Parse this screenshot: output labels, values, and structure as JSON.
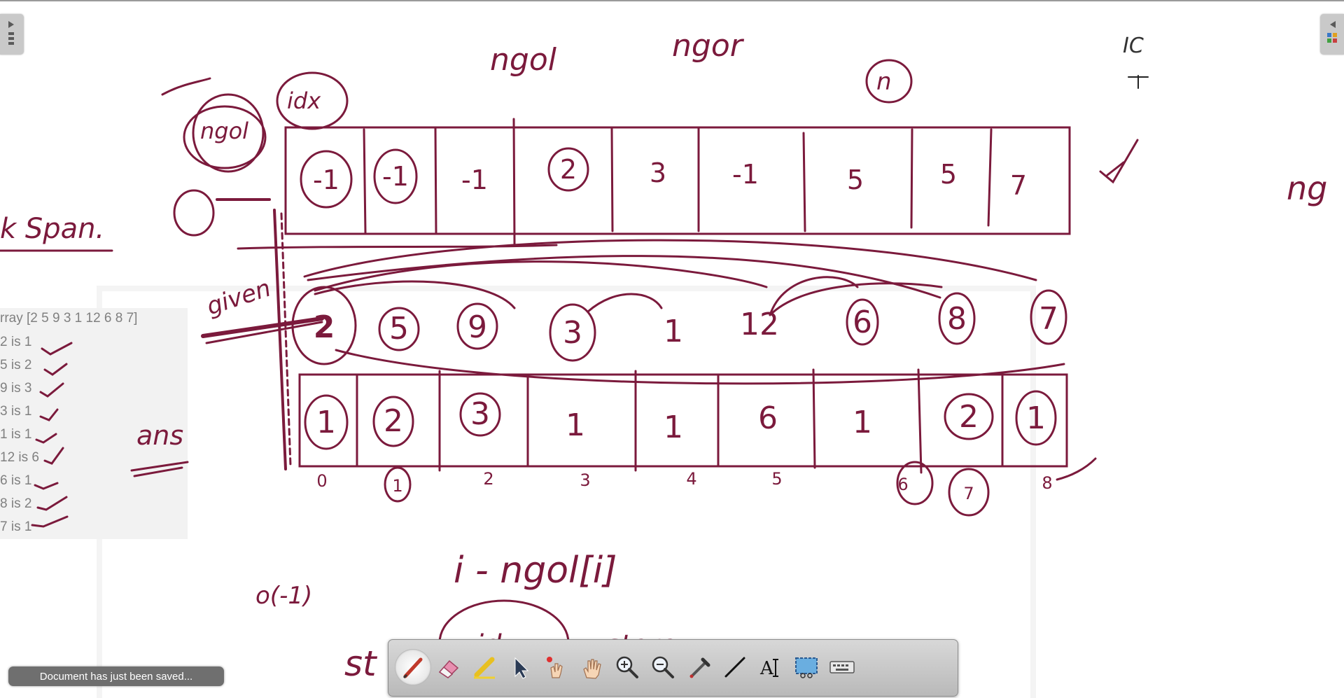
{
  "toast": {
    "message": "Document has just been saved..."
  },
  "side_panel": {
    "header": "rray [2 5 9 3 1 12 6 8 7]",
    "rows": [
      "2 is 1",
      "5 is 2",
      "9 is 3",
      "3 is 1",
      "1 is 1",
      "12 is 6",
      "6 is 1",
      "8 is 2",
      "7 is 1"
    ]
  },
  "whiteboard": {
    "ink_color": "#7b1a3c",
    "labels": {
      "ngol_top": "ngol",
      "ngor_top": "ngor",
      "ic": "IC",
      "n_circle": "n",
      "ngol_circle": "ngol",
      "idx_circle": "idx",
      "span": "k Span.",
      "given": "given",
      "ans": "ans",
      "ng_right": "ng",
      "formula": "i - ngol[i]",
      "zero_minus": "o(-1)",
      "st": "st",
      "idx_bottom": "idx",
      "store": "store"
    },
    "ngol_row": [
      "-1",
      "-1",
      "-1",
      "2",
      "3",
      "-1",
      "5",
      "5",
      "7"
    ],
    "given_row": [
      "2",
      "5",
      "9",
      "3",
      "1",
      "12",
      "6",
      "8",
      "7"
    ],
    "ans_row": [
      "1",
      "2",
      "3",
      "1",
      "1",
      "6",
      "1",
      "2",
      "1"
    ],
    "index_row": [
      "0",
      "1",
      "2",
      "3",
      "4",
      "5",
      "6",
      "7",
      "8"
    ]
  },
  "toolbar": {
    "tools": [
      {
        "name": "pen-tool",
        "icon": "pen-icon",
        "active": true
      },
      {
        "name": "eraser-tool",
        "icon": "eraser-icon",
        "active": false
      },
      {
        "name": "highlighter-tool",
        "icon": "highlighter-icon",
        "active": false
      },
      {
        "name": "select-tool",
        "icon": "cursor-icon",
        "active": false
      },
      {
        "name": "laser-pointer-tool",
        "icon": "laser-hand-icon",
        "active": false
      },
      {
        "name": "pan-tool",
        "icon": "hand-icon",
        "active": false
      },
      {
        "name": "zoom-in-tool",
        "icon": "zoom-in-icon",
        "active": false
      },
      {
        "name": "zoom-out-tool",
        "icon": "zoom-out-icon",
        "active": false
      },
      {
        "name": "color-picker-tool",
        "icon": "eyedropper-icon",
        "active": false
      },
      {
        "name": "line-tool",
        "icon": "line-icon",
        "active": false
      },
      {
        "name": "text-tool",
        "icon": "text-icon",
        "active": false
      },
      {
        "name": "screenshot-tool",
        "icon": "screen-capture-icon",
        "active": false
      },
      {
        "name": "keyboard-tool",
        "icon": "keyboard-icon",
        "active": false
      }
    ]
  }
}
